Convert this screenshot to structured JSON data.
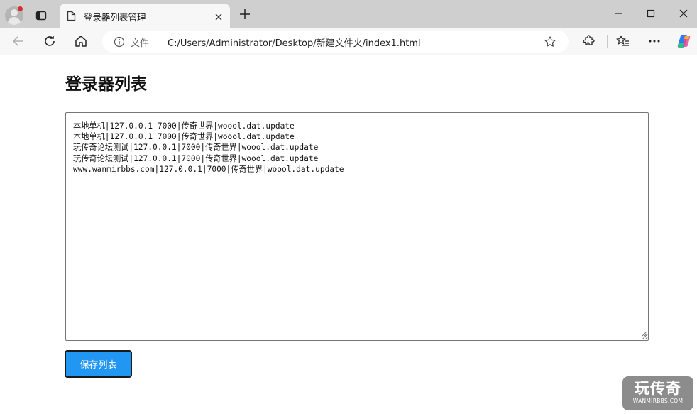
{
  "browser": {
    "tab_title": "登录器列表管理",
    "address_label": "文件",
    "url": "C:/Users/Administrator/Desktop/新建文件夹/index1.html"
  },
  "page": {
    "heading": "登录器列表",
    "list_text": "本地单机|127.0.0.1|7000|传奇世界|woool.dat.update\n本地单机|127.0.0.1|7000|传奇世界|woool.dat.update\n玩传奇论坛测试|127.0.0.1|7000|传奇世界|woool.dat.update\n玩传奇论坛测试|127.0.0.1|7000|传奇世界|woool.dat.update\nwww.wanmirbbs.com|127.0.0.1|7000|传奇世界|woool.dat.update",
    "save_button": "保存列表"
  },
  "watermark": {
    "main": "玩传奇",
    "sub": "WANMIRBBS.COM"
  },
  "colors": {
    "accent": "#2196f3",
    "notification_dot": "#d62d2d"
  }
}
